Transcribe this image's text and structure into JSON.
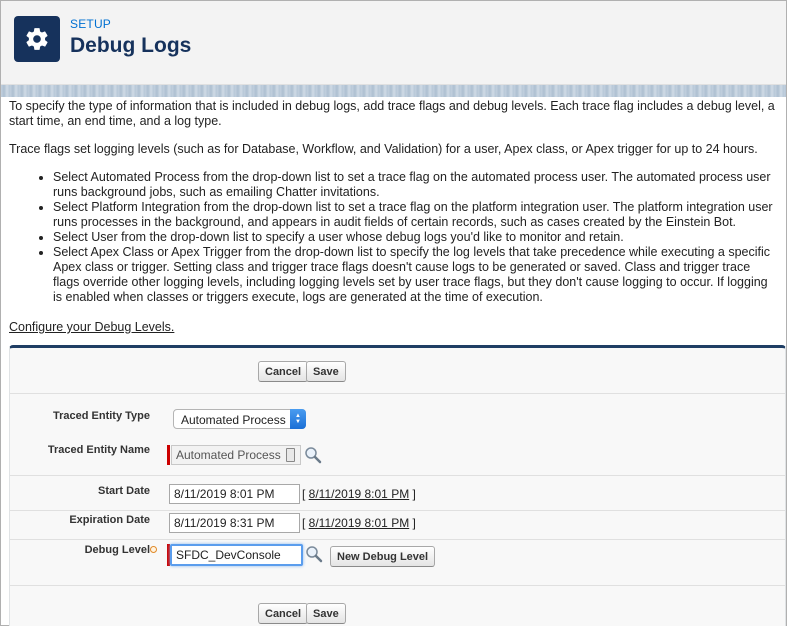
{
  "header": {
    "section_label": "SETUP",
    "title": "Debug Logs",
    "icon": "gear-icon"
  },
  "intro": {
    "para1": "To specify the type of information that is included in debug logs, add trace flags and debug levels. Each trace flag includes a debug level, a start time, an end time, and a log type.",
    "para2": "Trace flags set logging levels (such as for Database, Workflow, and Validation) for a user, Apex class, or Apex trigger for up to 24 hours.",
    "bullets": [
      "Select Automated Process from the drop-down list to set a trace flag on the automated process user. The automated process user runs background jobs, such as emailing Chatter invitations.",
      "Select Platform Integration from the drop-down list to set a trace flag on the platform integration user. The platform integration user runs processes in the background, and appears in audit fields of certain records, such as cases created by the Einstein Bot.",
      "Select User from the drop-down list to specify a user whose debug logs you'd like to monitor and retain.",
      "Select Apex Class or Apex Trigger from the drop-down list to specify the log levels that take precedence while executing a specific Apex class or trigger. Setting class and trigger trace flags doesn't cause logs to be generated or saved. Class and trigger trace flags override other logging levels, including logging levels set by user trace flags, but they don't cause logging to occur. If logging is enabled when classes or triggers execute, logs are generated at the time of execution."
    ],
    "config_link": "Configure your Debug Levels."
  },
  "buttons": {
    "cancel": "Cancel",
    "save": "Save",
    "new_debug_level": "New Debug Level"
  },
  "form": {
    "entity_type_label": "Traced Entity Type",
    "entity_type_value": "Automated Process",
    "entity_name_label": "Traced Entity Name",
    "entity_name_value": "Automated Process",
    "start_date_label": "Start Date",
    "start_date_value": "8/11/2019 8:01 PM",
    "start_date_link": "8/11/2019 8:01 PM",
    "expiration_date_label": "Expiration Date",
    "expiration_date_value": "8/11/2019 8:31 PM",
    "expiration_date_link": "8/11/2019 8:01 PM",
    "debug_level_label": "Debug Level",
    "debug_level_value": "SFDC_DevConsole"
  },
  "colors": {
    "brand_navy": "#16325c",
    "link_blue": "#0070d2",
    "required_red": "#cc0000",
    "select_blue": "#1a6fd6"
  }
}
